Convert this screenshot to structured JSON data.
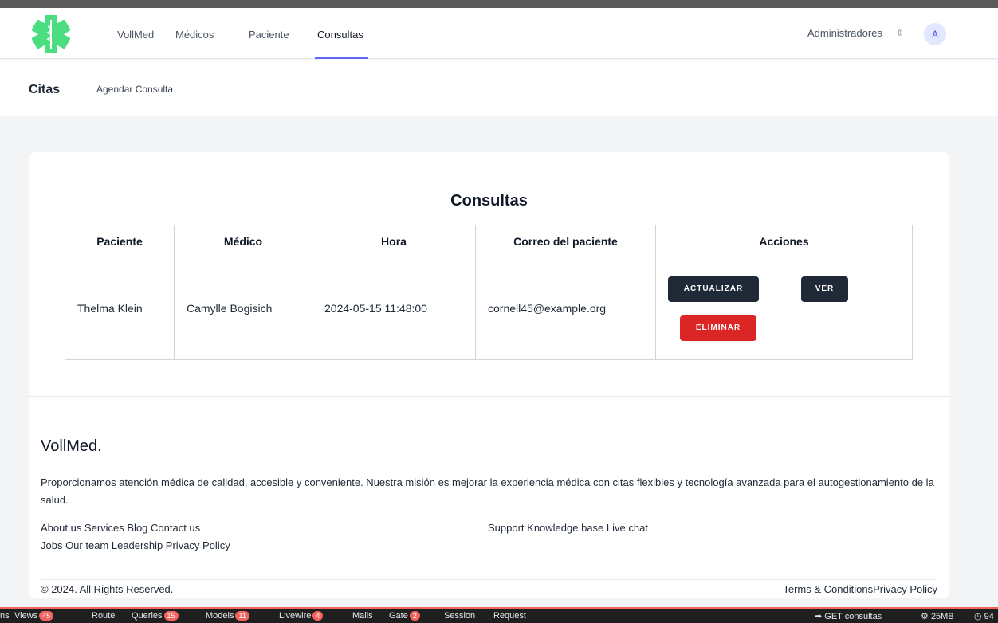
{
  "nav": {
    "links": [
      "VollMed",
      "Médicos",
      "Paciente",
      "Consultas"
    ],
    "user_menu": "Administradores",
    "avatar_initial": "A"
  },
  "subheader": {
    "title": "Citas",
    "link": "Agendar Consulta"
  },
  "table": {
    "title": "Consultas",
    "headers": [
      "Paciente",
      "Médico",
      "Hora",
      "Correo del paciente",
      "Acciones"
    ],
    "rows": [
      {
        "paciente": "Thelma Klein",
        "medico": "Camylle Bogisich",
        "hora": "2024-05-15 11:48:00",
        "correo": "cornell45@example.org"
      }
    ],
    "actions": {
      "update": "ACTUALIZAR",
      "view": "VER",
      "delete": "ELIMINAR"
    }
  },
  "footer": {
    "brand": "VollMed.",
    "description": "Proporcionamos atención médica de calidad, accesible y conveniente. Nuestra misión es mejorar la experiencia médica con citas flexibles y tecnología avanzada para el autogestionamiento de la salud.",
    "links_row1": "About us Services Blog Contact us",
    "links_row2": "Jobs Our team Leadership Privacy Policy",
    "links_right": "Support Knowledge base Live chat",
    "copyright": "© 2024. All Rights Reserved.",
    "terms": "Terms & ConditionsPrivacy Policy"
  },
  "debugbar": {
    "items": [
      {
        "label": "ns"
      },
      {
        "label": "Views",
        "count": "45"
      },
      {
        "label": "Route"
      },
      {
        "label": "Queries",
        "count": "15"
      },
      {
        "label": "Models",
        "count": "11"
      },
      {
        "label": "Livewire",
        "count": "4"
      },
      {
        "label": "Mails"
      },
      {
        "label": "Gate",
        "count": "2"
      },
      {
        "label": "Session"
      },
      {
        "label": "Request"
      }
    ],
    "route": "GET consultas",
    "memory": "25MB",
    "time": "94"
  },
  "colors": {
    "accent": "#6366f1",
    "primary_button": "#1f2937",
    "danger_button": "#dc2626",
    "debugbar_accent": "#f4645f"
  }
}
